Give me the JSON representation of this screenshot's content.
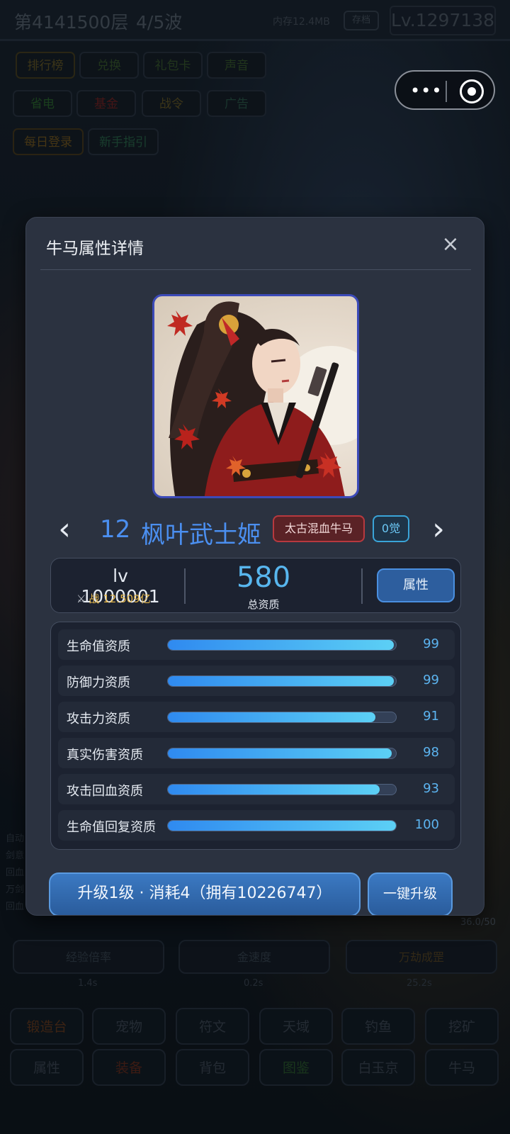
{
  "topbar": {
    "floor": "第4141500层",
    "wave": "4/5波",
    "memory": "内存12.4MB",
    "save_label": "存档",
    "level": "Lv.1297138"
  },
  "menu_row1": [
    "排行榜",
    "兑换",
    "礼包卡",
    "声音"
  ],
  "menu_row2": [
    "省电",
    "基金",
    "战令",
    "广告"
  ],
  "menu_row3": [
    "每日登录",
    "新手指引"
  ],
  "actions": {
    "labels": [
      "经验倍率",
      "金速度",
      "万劫成罡"
    ],
    "values": [
      "1.4s",
      "0.2s",
      "25.2s"
    ],
    "counter": "36.0/50"
  },
  "bottom_nav_row1": [
    "锻造台",
    "宠物",
    "符文",
    "天域",
    "钓鱼",
    "挖矿"
  ],
  "bottom_nav_row2": [
    "属性",
    "装备",
    "背包",
    "图鉴",
    "白玉京",
    "牛马"
  ],
  "left_log": [
    "自动",
    "剑意",
    "回血",
    "万剑",
    "回血"
  ],
  "capsule": {
    "more_icon": "more-dots-icon",
    "record_icon": "record-icon"
  },
  "modal": {
    "title": "牛马属性详情",
    "close_label": "×",
    "prev_label": "‹",
    "next_label": "›",
    "hero_number": "12",
    "hero_name": "枫叶武士姬",
    "tag_bloodline": "太古混血牛马",
    "tag_awaken": "0觉",
    "level": "lv 1000001",
    "power_label": "战 12.509亿",
    "total_value": "580",
    "total_label": "总资质",
    "attr_button": "属性",
    "stats": [
      {
        "label": "生命值资质",
        "value": "99",
        "fraction": 0.99
      },
      {
        "label": "防御力资质",
        "value": "99",
        "fraction": 0.99
      },
      {
        "label": "攻击力资质",
        "value": "91",
        "fraction": 0.91
      },
      {
        "label": "真实伤害资质",
        "value": "98",
        "fraction": 0.98
      },
      {
        "label": "攻击回血资质",
        "value": "93",
        "fraction": 0.93
      },
      {
        "label": "生命值回复资质",
        "value": "100",
        "fraction": 1.0
      }
    ],
    "upgrade_button": "升级1级 · 消耗4（拥有10226747）",
    "onekey_button": "一键升级"
  },
  "colors": {
    "accent_blue": "#4b8ff0",
    "stat_value": "#5cb4f0",
    "tag_red": "#b7393f",
    "tag_cyan": "#3aa4d8",
    "power_gold": "#e2b54a"
  }
}
